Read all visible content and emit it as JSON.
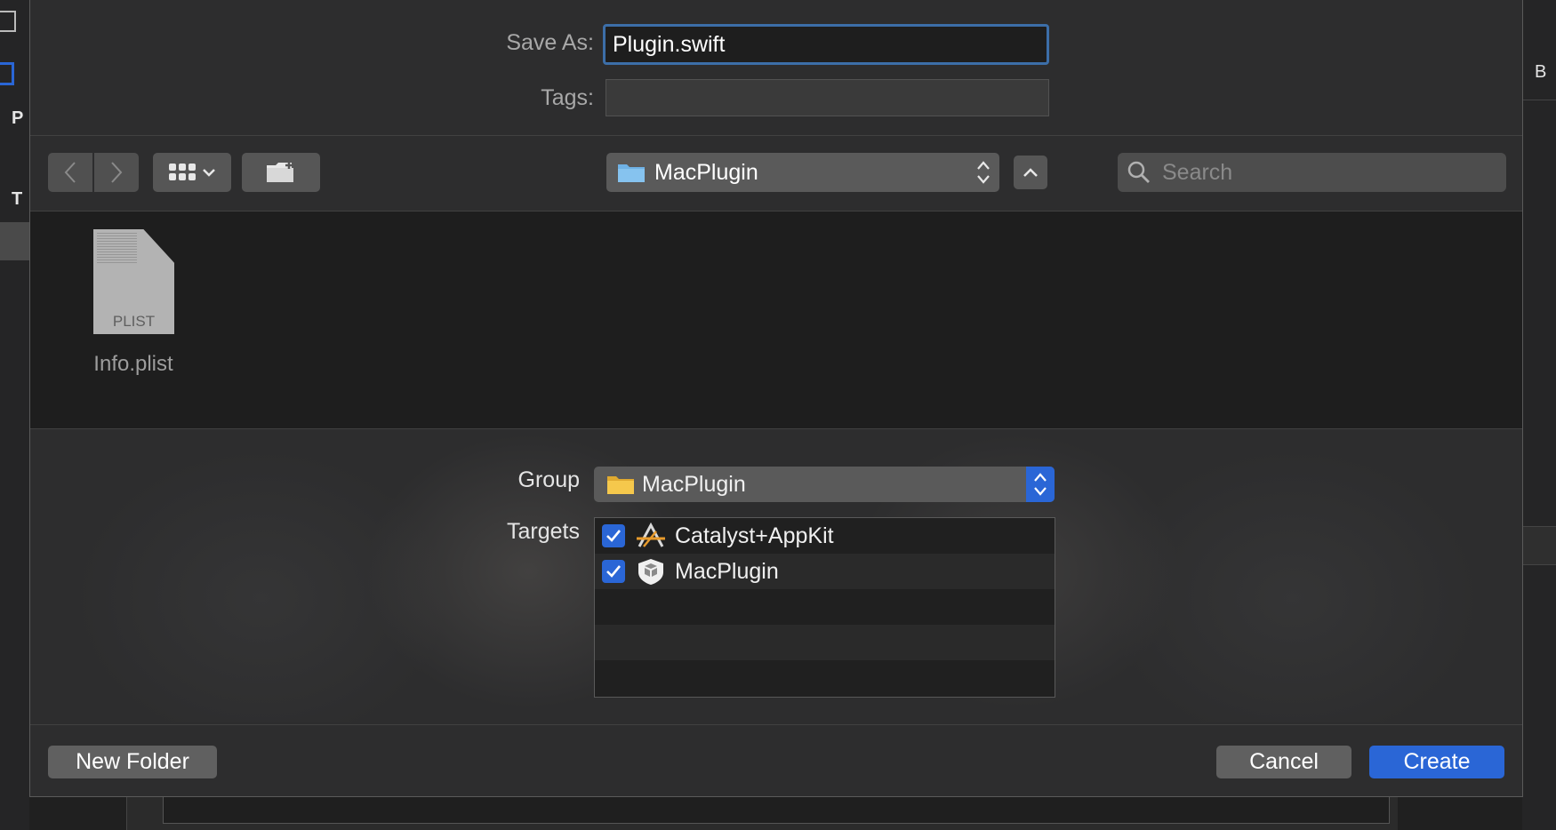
{
  "background": {
    "left_text_1": "P",
    "left_text_2": "T",
    "right_text": "B"
  },
  "dialog": {
    "save_as_label": "Save As:",
    "save_as_value": "Plugin.swift",
    "tags_label": "Tags:",
    "tags_value": ""
  },
  "toolbar": {
    "back_icon": "chevron-left-icon",
    "forward_icon": "chevron-right-icon",
    "view_mode_icon": "icon-grid-icon",
    "new_folder_icon": "folder-plus-icon",
    "location": "MacPlugin",
    "collapse_icon": "chevron-up-icon",
    "search_placeholder": "Search"
  },
  "browser": {
    "files": [
      {
        "name": "Info.plist",
        "type_label": "PLIST"
      }
    ]
  },
  "options": {
    "group_label": "Group",
    "group_value": "MacPlugin",
    "targets_label": "Targets",
    "targets": [
      {
        "name": "Catalyst+AppKit",
        "checked": true,
        "icon": "app-target-icon"
      },
      {
        "name": "MacPlugin",
        "checked": true,
        "icon": "bundle-target-icon"
      }
    ]
  },
  "footer": {
    "new_folder_label": "New Folder",
    "cancel_label": "Cancel",
    "create_label": "Create"
  },
  "colors": {
    "accent": "#2a66d6",
    "focus_ring": "#3c6ea8",
    "sheet_bg": "#2d2d2e",
    "browser_bg": "#1e1e1e",
    "folder_blue": "#6fb2e6",
    "folder_yellow": "#f5c84c"
  }
}
